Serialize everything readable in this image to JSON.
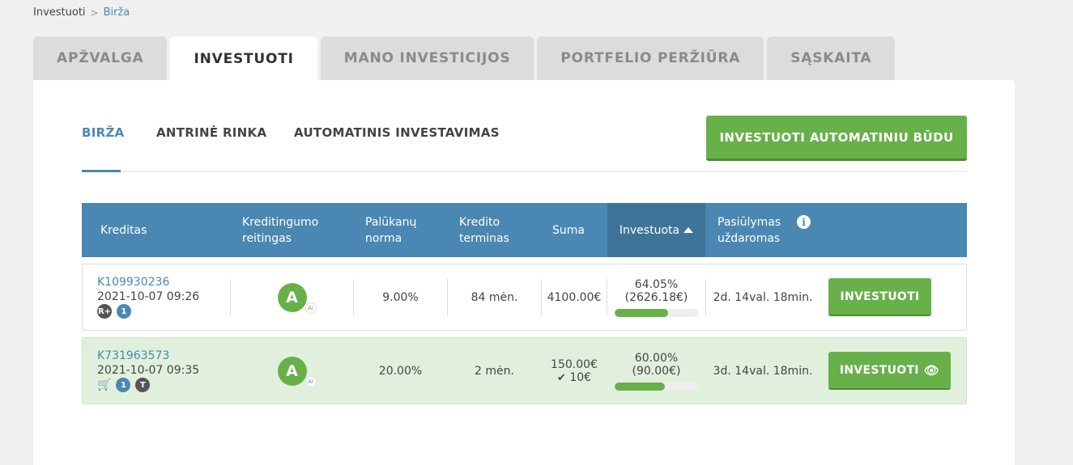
{
  "breadcrumb": {
    "home": "Investuoti",
    "separator": ">",
    "current": "Birža"
  },
  "main_tabs": [
    "APŽVALGA",
    "INVESTUOTI",
    "MANO INVESTICIJOS",
    "PORTFELIO PERŽIŪRA",
    "SĄSKAITA"
  ],
  "active_main_tab": "INVESTUOTI",
  "sub_tabs": [
    "BIRŽA",
    "ANTRINĖ RINKA",
    "AUTOMATINIS INVESTAVIMAS"
  ],
  "active_sub_tab": "BIRŽA",
  "auto_invest_button": "INVESTUOTI AUTOMATINIU BŪDU",
  "table": {
    "headers": {
      "credit": "Kreditas",
      "rating_1": "Kreditingumo",
      "rating_2": "reitingas",
      "rate_1": "Palūkanų",
      "rate_2": "norma",
      "term_1": "Kredito",
      "term_2": "terminas",
      "amount": "Suma",
      "invested": "Investuota",
      "offer_1": "Pasiūlymas",
      "offer_2": "uždaromas"
    },
    "rows": [
      {
        "id": "K109930236",
        "date": "2021-10-07 09:26",
        "badge_a": "R+",
        "badge_b": "1",
        "rating": "A",
        "rating_sub": "AI",
        "rate": "9.00%",
        "term": "84 mėn.",
        "amount": "4100.00€",
        "invested_pct": "64.05%",
        "invested_amt": "(2626.18€)",
        "progress": 0.6405,
        "closes": "2d. 14val. 18min.",
        "button": "INVESTUOTI"
      },
      {
        "id": "K731963573",
        "date": "2021-10-07 09:35",
        "badge_b": "1",
        "badge_c": "T",
        "rating": "A",
        "rating_sub": "AI",
        "rate": "20.00%",
        "term": "2 mėn.",
        "amount": "150.00€",
        "my_investment": "10€",
        "invested_pct": "60.00%",
        "invested_amt": "(90.00€)",
        "progress": 0.6,
        "closes": "3d. 14val. 18min.",
        "button": "INVESTUOTI"
      }
    ]
  },
  "colors": {
    "accent_blue": "#4a87b2",
    "accent_green": "#68b04a",
    "highlight_row": "#e1f0dc"
  },
  "icons": [
    "chevron-right-icon",
    "sort-up-icon",
    "info-icon",
    "cart-icon",
    "checkmark-icon",
    "eye-icon"
  ]
}
